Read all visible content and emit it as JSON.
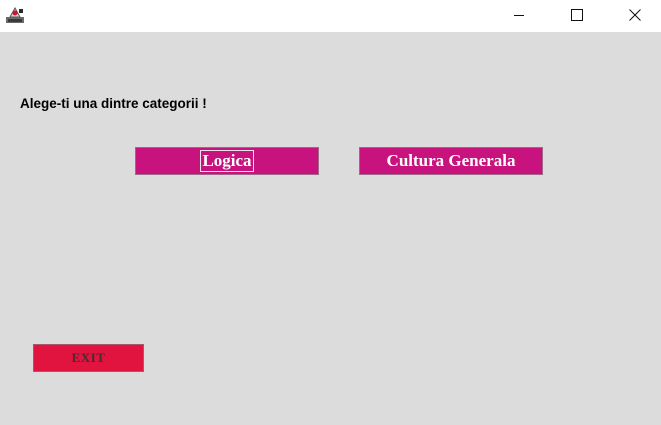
{
  "window": {
    "app_icon": "java-cup-icon",
    "controls": {
      "minimize": "minimize-icon",
      "maximize": "maximize-icon",
      "close": "close-icon"
    }
  },
  "main": {
    "prompt": "Alege-ti una dintre categorii !",
    "categories": [
      {
        "label": "Logica",
        "focused": true
      },
      {
        "label": "Cultura Generala",
        "focused": false
      }
    ],
    "exit_label": "EXIT"
  },
  "colors": {
    "background": "#dcdcdc",
    "category_button": "#c8127e",
    "exit_button": "#e0143f"
  }
}
